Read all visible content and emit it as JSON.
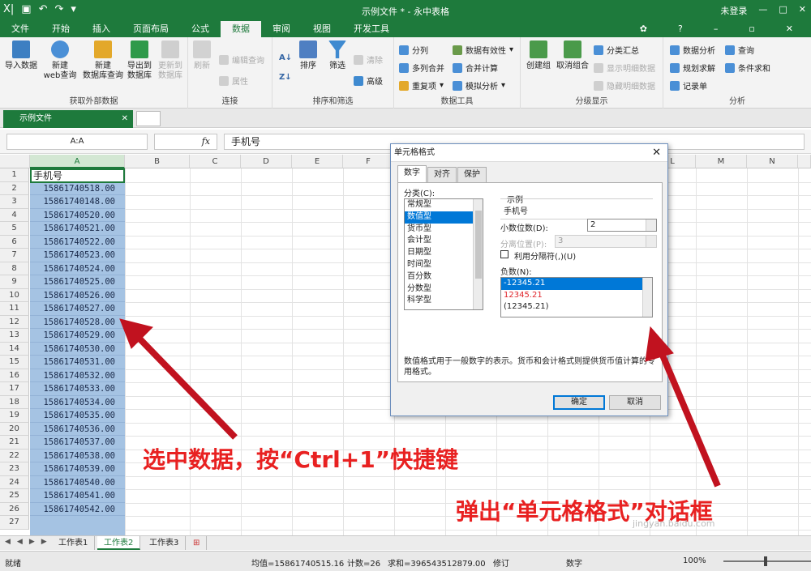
{
  "titlebar": {
    "title": "示例文件 * - 永中表格",
    "login": "未登录"
  },
  "menu": [
    "文件",
    "开始",
    "插入",
    "页面布局",
    "公式",
    "数据",
    "审阅",
    "视图",
    "开发工具"
  ],
  "ribbon": {
    "get_external": {
      "label": "获取外部数据",
      "btn1": "导入数据",
      "btn2a": "新建",
      "btn2b": "web查询",
      "btn3a": "新建",
      "btn3b": "数据库查询",
      "btn4a": "导出到",
      "btn4b": "数据库",
      "btn5a": "更新到",
      "btn5b": "数据库"
    },
    "connect": {
      "label": "连接",
      "refresh": "刷新",
      "edit_query": "编辑查询",
      "props": "属性"
    },
    "sort": {
      "label": "排序和筛选",
      "sort": "排序",
      "filter": "筛选",
      "clear": "清除",
      "advanced": "高级"
    },
    "tools": {
      "label": "数据工具",
      "split": "分列",
      "multimerge": "多列合并",
      "dup": "重复项",
      "validity": "数据有效性",
      "consolidate": "合并计算",
      "whatif": "模拟分析"
    },
    "outline": {
      "label": "分级显示",
      "group": "创建组",
      "ungroup": "取消组合",
      "subtotal": "分类汇总",
      "show": "显示明细数据",
      "hide": "隐藏明细数据"
    },
    "analysis": {
      "label": "分析",
      "analyze": "数据分析",
      "query": "查询",
      "solver": "规划求解",
      "sumif": "条件求和",
      "record": "记录单"
    }
  },
  "doctab": "示例文件",
  "formula": {
    "namebox": "A:A",
    "fx": "fx",
    "value": "手机号"
  },
  "columns": [
    "A",
    "B",
    "C",
    "D",
    "E",
    "F",
    "G",
    "H",
    "I",
    "J",
    "K",
    "L",
    "M",
    "N"
  ],
  "rows": [
    "1",
    "2",
    "3",
    "4",
    "5",
    "6",
    "7",
    "8",
    "9",
    "10",
    "11",
    "12",
    "13",
    "14",
    "15",
    "16",
    "17",
    "18",
    "19",
    "20",
    "21",
    "22",
    "23",
    "24",
    "25",
    "26",
    "27"
  ],
  "header_cell": "手机号",
  "cells": [
    "15861740518.00",
    "15861740148.00",
    "15861740520.00",
    "15861740521.00",
    "15861740522.00",
    "15861740523.00",
    "15861740524.00",
    "15861740525.00",
    "15861740526.00",
    "15861740527.00",
    "15861740528.00",
    "15861740529.00",
    "15861740530.00",
    "15861740531.00",
    "15861740532.00",
    "15861740533.00",
    "15861740534.00",
    "15861740535.00",
    "15861740536.00",
    "15861740537.00",
    "15861740538.00",
    "15861740539.00",
    "15861740540.00",
    "15861740541.00",
    "15861740542.00"
  ],
  "sheets": [
    "工作表1",
    "工作表2",
    "工作表3"
  ],
  "status": {
    "ready": "就绪",
    "avg": "均值=15861740515.16",
    "count": "计数=26",
    "sum": "求和=396543512879.00",
    "rev": "修订",
    "num": "数字",
    "zoom": "100%"
  },
  "dialog": {
    "title": "单元格格式",
    "tabs": [
      "数字",
      "对齐",
      "保护"
    ],
    "category_label": "分类(C):",
    "categories": [
      "常规型",
      "数值型",
      "货币型",
      "会计型",
      "日期型",
      "时间型",
      "百分数",
      "分数型",
      "科学型"
    ],
    "sample_label": "示例",
    "sample_value": "手机号",
    "decimals_label": "小数位数(D):",
    "decimals_value": "2",
    "align_label": "分离位置(P):",
    "align_value": "3",
    "separator_label": "利用分隔符(,)(U)",
    "negative_label": "负数(N):",
    "negatives": [
      "-12345.21",
      "12345.21",
      "(12345.21)"
    ],
    "desc": "数值格式用于一般数字的表示。货币和会计格式则提供货币值计算的专用格式。",
    "ok": "确定",
    "cancel": "取消"
  },
  "annotations": {
    "a1": "选中数据，按“Ctrl+1”快捷键",
    "a2": "弹出“单元格格式”对话框"
  },
  "watermark": "jingyan.baidu.com"
}
